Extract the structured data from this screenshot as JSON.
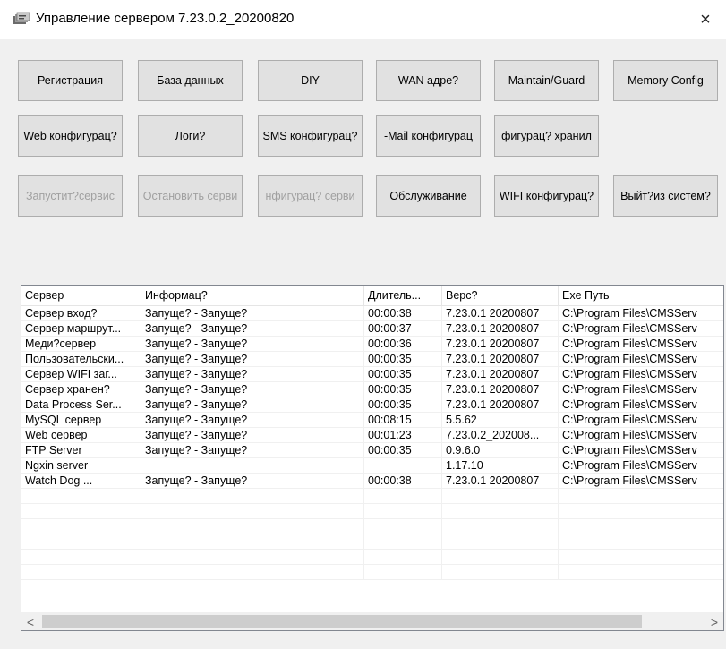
{
  "window": {
    "title": "Управление сервером 7.23.0.2_20200820",
    "close_glyph": "×"
  },
  "buttons": {
    "row1": [
      {
        "label": "Регистрация",
        "enabled": true
      },
      {
        "label": "База данных",
        "enabled": true
      },
      {
        "label": "DIY",
        "enabled": true
      },
      {
        "label": "WAN адре?",
        "enabled": true
      },
      {
        "label": "Maintain/Guard",
        "enabled": true
      },
      {
        "label": "Memory Config",
        "enabled": true
      }
    ],
    "row2": [
      {
        "label": "Web конфигурац?",
        "enabled": true
      },
      {
        "label": "Логи?",
        "enabled": true
      },
      {
        "label": "SMS конфигурац?",
        "enabled": true
      },
      {
        "label": "-Mail конфигурац",
        "enabled": true
      },
      {
        "label": "фигурац? хранил",
        "enabled": true
      }
    ],
    "row3": [
      {
        "label": "Запустит?сервис",
        "enabled": false
      },
      {
        "label": "Остановить серви",
        "enabled": false
      },
      {
        "label": "нфигурац? серви",
        "enabled": false
      },
      {
        "label": "Обслуживание",
        "enabled": true
      },
      {
        "label": "WIFI конфигурац?",
        "enabled": true
      },
      {
        "label": "Выйт?из систем?",
        "enabled": true
      }
    ]
  },
  "table": {
    "columns": [
      "Сервер",
      "Информац?",
      "Длитель...",
      "Верс?",
      "Exe Путь"
    ],
    "rows": [
      [
        "Сервер вход?",
        "Запуще? - Запуще?",
        "00:00:38",
        "7.23.0.1 20200807",
        "C:\\Program Files\\CMSServ"
      ],
      [
        "Сервер маршрут...",
        "Запуще? - Запуще?",
        "00:00:37",
        "7.23.0.1 20200807",
        "C:\\Program Files\\CMSServ"
      ],
      [
        "Меди?сервер",
        "Запуще? - Запуще?",
        "00:00:36",
        "7.23.0.1 20200807",
        "C:\\Program Files\\CMSServ"
      ],
      [
        "Пользовательски...",
        "Запуще? - Запуще?",
        "00:00:35",
        "7.23.0.1 20200807",
        "C:\\Program Files\\CMSServ"
      ],
      [
        "Сервер WIFI заг...",
        "Запуще? - Запуще?",
        "00:00:35",
        "7.23.0.1 20200807",
        "C:\\Program Files\\CMSServ"
      ],
      [
        "Сервер хранен?",
        "Запуще? - Запуще?",
        "00:00:35",
        "7.23.0.1 20200807",
        "C:\\Program Files\\CMSServ"
      ],
      [
        "Data Process Ser...",
        "Запуще? - Запуще?",
        "00:00:35",
        "7.23.0.1 20200807",
        "C:\\Program Files\\CMSServ"
      ],
      [
        "MySQL сервер",
        "Запуще? - Запуще?",
        "00:08:15",
        "5.5.62",
        "C:\\Program Files\\CMSServ"
      ],
      [
        "Web сервер",
        "Запуще? - Запуще?",
        "00:01:23",
        "7.23.0.2_202008...",
        "C:\\Program Files\\CMSServ"
      ],
      [
        "FTP Server",
        "Запуще? - Запуще?",
        "00:00:35",
        "0.9.6.0",
        "C:\\Program Files\\CMSServ"
      ],
      [
        "Ngxin server",
        "",
        "",
        "1.17.10",
        "C:\\Program Files\\CMSServ"
      ],
      [
        "Watch Dog        ...",
        "Запуще? - Запуще?",
        "00:00:38",
        "7.23.0.1 20200807",
        "C:\\Program Files\\CMSServ"
      ]
    ],
    "empty_rows": 6
  },
  "scrollbar": {
    "left_glyph": "<",
    "right_glyph": ">"
  },
  "colors": {
    "button_face": "#e1e1e1",
    "button_border": "#adadad",
    "disabled_text": "#a0a0a0",
    "window_bg": "#f0f0f0"
  }
}
